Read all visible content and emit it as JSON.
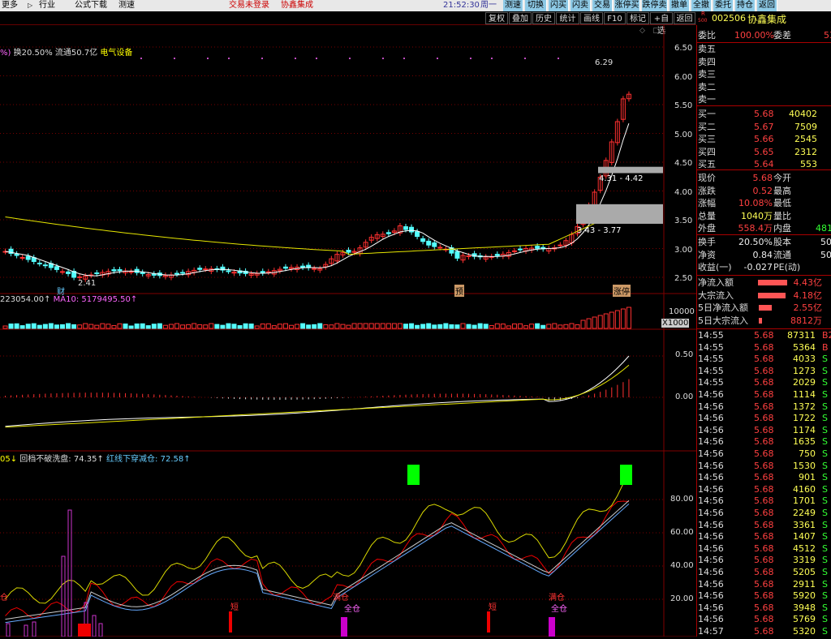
{
  "topbar": {
    "menu": [
      "更多",
      "行业",
      "公式下载",
      "测速"
    ],
    "status_left": "交易未登录",
    "stock_name": "协鑫集成",
    "time": "21:52:30",
    "weekday": "周一",
    "quick_buttons": [
      "测速",
      "切换",
      "闪买",
      "闪卖",
      "交易",
      "涨停买",
      "跌停卖",
      "撤单",
      "全撤",
      "委托",
      "持仓",
      "返回"
    ]
  },
  "toolbar": {
    "items": [
      "复权",
      "叠加",
      "历史",
      "统计",
      "画线",
      "F10",
      "标记",
      "+自选",
      "返回"
    ]
  },
  "header": {
    "code": "002506",
    "name": "协鑫集成",
    "mkt_top": "R",
    "mkt_bottom": "500"
  },
  "price_chart": {
    "info_prefix": "%)",
    "turnover": "换20.50%",
    "float": "流通50.7亿",
    "industry": "电气设备",
    "label_high": "6.29",
    "label_low": "2.41",
    "box_upper": "4.31 - 4.42",
    "box_lower": "3.43 - 3.77",
    "tag_cai": "财",
    "tag_yu": "预",
    "tag_zhangting": "涨停",
    "y_ticks": [
      "6.50",
      "6.00",
      "5.50",
      "5.00",
      "4.50",
      "4.00",
      "3.50",
      "3.00",
      "2.50"
    ]
  },
  "volume_chart": {
    "vol_value": "223054.00↑",
    "ma10": "MA10: 5179495.50↑",
    "ytick": "10000",
    "unit": "X1000"
  },
  "macd_chart": {
    "y_ticks": [
      "0.50",
      "0.00"
    ]
  },
  "ind_chart": {
    "prefix": "05↓",
    "line1": "回档不破洗盘: 74.35↑",
    "line2": "红线下穿减仓: 72.58↑",
    "y_ticks": [
      "80.00",
      "60.00",
      "40.00",
      "20.00"
    ],
    "signals": [
      "短",
      "满仓",
      "全仓",
      "短",
      "满仓",
      "全仓",
      "仓"
    ]
  },
  "quote": {
    "weibi_label": "委比",
    "weibi": "100.00%",
    "weicha_label": "委差",
    "weicha": "53",
    "sells": [
      "卖五",
      "卖四",
      "卖三",
      "卖二",
      "卖一"
    ],
    "buys": [
      {
        "label": "买一",
        "price": "5.68",
        "vol": "40402"
      },
      {
        "label": "买二",
        "price": "5.67",
        "vol": "7509"
      },
      {
        "label": "买三",
        "price": "5.66",
        "vol": "2545"
      },
      {
        "label": "买四",
        "price": "5.65",
        "vol": "2312"
      },
      {
        "label": "买五",
        "price": "5.64",
        "vol": "553"
      }
    ],
    "stats": [
      {
        "l1": "现价",
        "v1": "5.68",
        "l2": "今开",
        "v2": ""
      },
      {
        "l1": "涨跌",
        "v1": "0.52",
        "l2": "最高",
        "v2": ""
      },
      {
        "l1": "涨幅",
        "v1": "10.08%",
        "l2": "最低",
        "v2": ""
      },
      {
        "l1": "总量",
        "v1": "1040万",
        "l2": "量比",
        "v2": ""
      },
      {
        "l1": "外盘",
        "v1": "558.4万",
        "l2": "内盘",
        "v2": "481"
      }
    ],
    "stats2": [
      {
        "l1": "换手",
        "v1": "20.50%",
        "l2": "股本",
        "v2": "50"
      },
      {
        "l1": "净资",
        "v1": "0.84",
        "l2": "流通",
        "v2": "50"
      },
      {
        "l1": "收益(一)",
        "v1": "-0.027",
        "l2": "PE(动)",
        "v2": ""
      }
    ],
    "flows": [
      {
        "label": "净流入额",
        "value": "4.43亿",
        "bar": 0.9
      },
      {
        "label": "大宗流入",
        "value": "4.18亿",
        "bar": 0.85
      },
      {
        "label": "5日净流入额",
        "value": "2.55亿",
        "bar": 0.4
      },
      {
        "label": "5日大宗流入",
        "value": "8812万",
        "bar": 0.1
      }
    ]
  },
  "ticks": [
    {
      "t": "14:55",
      "p": "5.68",
      "v": "87311",
      "d": "B2"
    },
    {
      "t": "14:55",
      "p": "5.68",
      "v": "5364",
      "d": "B"
    },
    {
      "t": "14:55",
      "p": "5.68",
      "v": "4033",
      "d": "S"
    },
    {
      "t": "14:55",
      "p": "5.68",
      "v": "1273",
      "d": "S"
    },
    {
      "t": "14:55",
      "p": "5.68",
      "v": "2029",
      "d": "S"
    },
    {
      "t": "14:56",
      "p": "5.68",
      "v": "1114",
      "d": "S"
    },
    {
      "t": "14:56",
      "p": "5.68",
      "v": "1372",
      "d": "S"
    },
    {
      "t": "14:56",
      "p": "5.68",
      "v": "1722",
      "d": "S"
    },
    {
      "t": "14:56",
      "p": "5.68",
      "v": "1174",
      "d": "S"
    },
    {
      "t": "14:56",
      "p": "5.68",
      "v": "1635",
      "d": "S"
    },
    {
      "t": "14:56",
      "p": "5.68",
      "v": "750",
      "d": "S"
    },
    {
      "t": "14:56",
      "p": "5.68",
      "v": "1530",
      "d": "S"
    },
    {
      "t": "14:56",
      "p": "5.68",
      "v": "901",
      "d": "S"
    },
    {
      "t": "14:56",
      "p": "5.68",
      "v": "4160",
      "d": "S"
    },
    {
      "t": "14:56",
      "p": "5.68",
      "v": "1701",
      "d": "S"
    },
    {
      "t": "14:56",
      "p": "5.68",
      "v": "2249",
      "d": "S"
    },
    {
      "t": "14:56",
      "p": "5.68",
      "v": "3361",
      "d": "S"
    },
    {
      "t": "14:56",
      "p": "5.68",
      "v": "1407",
      "d": "S"
    },
    {
      "t": "14:56",
      "p": "5.68",
      "v": "4512",
      "d": "S"
    },
    {
      "t": "14:56",
      "p": "5.68",
      "v": "3319",
      "d": "S"
    },
    {
      "t": "14:56",
      "p": "5.68",
      "v": "5205",
      "d": "S"
    },
    {
      "t": "14:56",
      "p": "5.68",
      "v": "2911",
      "d": "S"
    },
    {
      "t": "14:56",
      "p": "5.68",
      "v": "5920",
      "d": "S"
    },
    {
      "t": "14:56",
      "p": "5.68",
      "v": "3948",
      "d": "S"
    },
    {
      "t": "14:56",
      "p": "5.68",
      "v": "5769",
      "d": "S"
    },
    {
      "t": "14:57",
      "p": "5.68",
      "v": "5320",
      "d": "S"
    }
  ],
  "colors": {
    "up": "#ff3030",
    "down": "#54ffff",
    "ma_white": "#ffffff",
    "ma_yellow": "#e6e600",
    "grid": "#800000"
  }
}
